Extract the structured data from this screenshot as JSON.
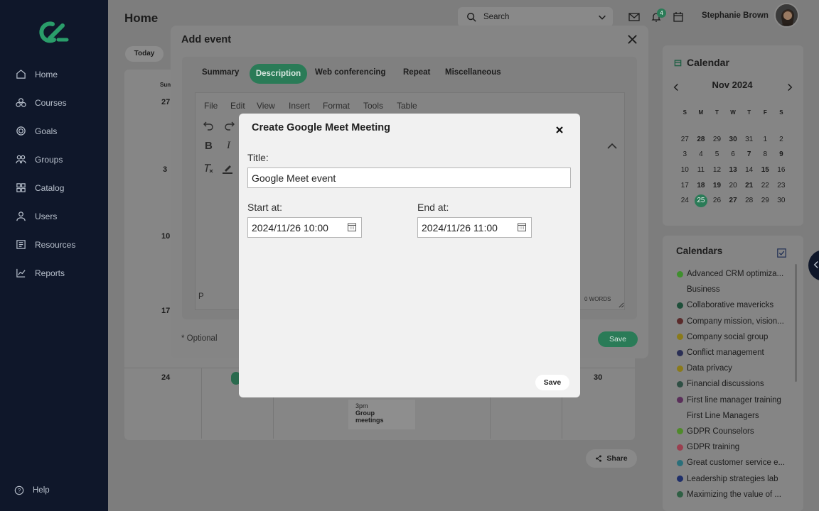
{
  "sidebar": {
    "items": [
      {
        "label": "Home",
        "icon": "home-icon"
      },
      {
        "label": "Courses",
        "icon": "courses-icon"
      },
      {
        "label": "Goals",
        "icon": "goals-icon"
      },
      {
        "label": "Groups",
        "icon": "groups-icon"
      },
      {
        "label": "Catalog",
        "icon": "catalog-icon"
      },
      {
        "label": "Users",
        "icon": "users-icon"
      },
      {
        "label": "Resources",
        "icon": "resources-icon"
      },
      {
        "label": "Reports",
        "icon": "reports-icon"
      }
    ],
    "help": "Help"
  },
  "header": {
    "title": "Home",
    "search_placeholder": "Search",
    "notification_count": "4",
    "username": "Stephanie Brown"
  },
  "calendar_board": {
    "today_label": "Today",
    "day_header": "Sun",
    "visible_dates": [
      "27",
      "3",
      "10",
      "17",
      "24",
      "30"
    ],
    "event": {
      "time": "3pm",
      "title": "Group meetings"
    },
    "share_label": "Share"
  },
  "mini_calendar": {
    "title": "Calendar",
    "month": "Nov 2024",
    "weekdays": [
      "S",
      "M",
      "T",
      "W",
      "T",
      "F",
      "S"
    ],
    "weeks": [
      [
        "27",
        "28",
        "29",
        "30",
        "31",
        "1",
        "2"
      ],
      [
        "3",
        "4",
        "5",
        "6",
        "7",
        "8",
        "9"
      ],
      [
        "10",
        "11",
        "12",
        "13",
        "14",
        "15",
        "16"
      ],
      [
        "17",
        "18",
        "19",
        "20",
        "21",
        "22",
        "23"
      ],
      [
        "24",
        "25",
        "26",
        "27",
        "28",
        "29",
        "30"
      ]
    ],
    "selected": "25"
  },
  "calendars": {
    "title": "Calendars",
    "items": [
      {
        "label": "Advanced CRM optimiza...",
        "color": "#3f8f2e"
      },
      {
        "label": "Business",
        "color": ""
      },
      {
        "label": "Collaborative mavericks",
        "color": "#1f4f3a"
      },
      {
        "label": "Company mission, vision...",
        "color": "#5a2a2a"
      },
      {
        "label": "Company social group",
        "color": "#8a7a1a"
      },
      {
        "label": "Conflict management",
        "color": "#2a2f55"
      },
      {
        "label": "Data privacy",
        "color": "#8a7a1a"
      },
      {
        "label": "Financial discussions",
        "color": "#2f4f44"
      },
      {
        "label": "First line manager training",
        "color": "#5a2f5a"
      },
      {
        "label": "First Line Managers",
        "color": ""
      },
      {
        "label": "GDPR Counselors",
        "color": "#4f8a2a"
      },
      {
        "label": "GDPR training",
        "color": "#9a3f4f"
      },
      {
        "label": "Great customer service e...",
        "color": "#2a6f7a"
      },
      {
        "label": "Leadership strategies lab",
        "color": "#1f2f6a"
      },
      {
        "label": "Maximizing the value of ...",
        "color": "#2f5f44"
      }
    ]
  },
  "add_event": {
    "title": "Add event",
    "tabs": [
      "Summary",
      "Description",
      "Web conferencing",
      "Repeat",
      "Miscellaneous"
    ],
    "active_tab": "Description",
    "editor_menu": [
      "File",
      "Edit",
      "View",
      "Insert",
      "Format",
      "Tools",
      "Table"
    ],
    "path_label": "P",
    "word_count": "0 WORDS",
    "optional_note": "* Optional",
    "save_label": "Save"
  },
  "meet_modal": {
    "title": "Create Google Meet Meeting",
    "title_label": "Title:",
    "title_value": "Google Meet event",
    "start_label": "Start at:",
    "start_value": "2024/11/26 10:00",
    "end_label": "End at:",
    "end_value": "2024/11/26 11:00",
    "save_label": "Save"
  },
  "colors": {
    "accent": "#2a7b57",
    "sidebar_bg": "#0f172a"
  }
}
